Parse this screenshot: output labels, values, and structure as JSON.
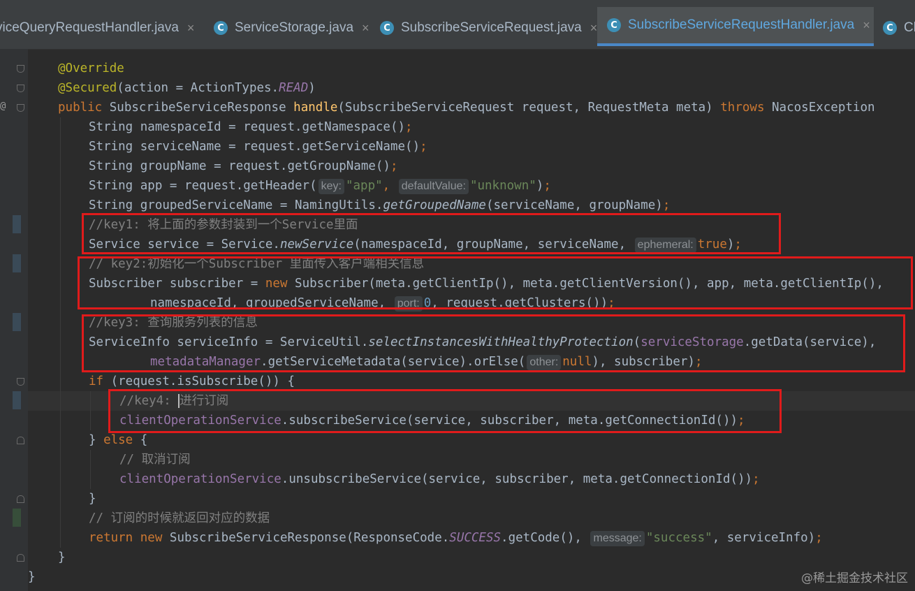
{
  "tabs": [
    {
      "name": "viceQueryRequestHandler.java",
      "icon": "java-class-icon",
      "icon_letter": "",
      "active": false
    },
    {
      "name": "ServiceStorage.java",
      "icon": "java-class-icon",
      "icon_letter": "C",
      "active": false
    },
    {
      "name": "SubscribeServiceRequest.java",
      "icon": "java-class-icon",
      "icon_letter": "C",
      "active": false
    },
    {
      "name": "SubscribeServiceRequestHandler.java",
      "icon": "java-class-icon",
      "icon_letter": "C",
      "active": true
    },
    {
      "name": "Cli",
      "icon": "java-class-icon",
      "icon_letter": "C",
      "active": false
    }
  ],
  "tab_close_glyph": "×",
  "gutter": {
    "override_marker": "@"
  },
  "code": {
    "l1": {
      "a": "@Override"
    },
    "l2": {
      "a": "@Secured",
      "b": "(action = ActionTypes.",
      "c": "READ",
      "d": ")"
    },
    "l3": {
      "a": "public ",
      "b": "SubscribeServiceResponse ",
      "c": "handle",
      "d": "(SubscribeServiceRequest request, RequestMeta meta) ",
      "e": "throws",
      "f": " NacosException"
    },
    "l4": {
      "a": "String namespaceId = request.getNamespace()",
      "b": ";"
    },
    "l5": {
      "a": "String serviceName = request.getServiceName()",
      "b": ";"
    },
    "l6": {
      "a": "String groupName = request.getGroupName()",
      "b": ";"
    },
    "l7": {
      "a": "String app = request.getHeader(",
      "hint1": "key:",
      "s1": "\"app\"",
      "c": ", ",
      "hint2": "defaultValue:",
      "s2": "\"unknown\"",
      "d": ")",
      "e": ";"
    },
    "l8": {
      "a": "String groupedServiceName = NamingUtils.",
      "b": "getGroupedName",
      "c": "(serviceName, groupName)",
      "d": ";"
    },
    "l9": {
      "a": "//key1: 将上面的参数封装到一个Service里面"
    },
    "l10": {
      "a": "Service service = Service.",
      "b": "newService",
      "c": "(namespaceId, groupName, serviceName, ",
      "hint": "ephemeral:",
      "d": "true",
      "e": ")",
      "f": ";"
    },
    "l11": {
      "a": "// key2:初始化一个Subscriber 里面传入客户端相关信息"
    },
    "l12": {
      "a": "Subscriber subscriber = ",
      "b": "new ",
      "c": "Subscriber(meta.getClientIp(), meta.getClientVersion(), app, meta.getClientIp(),"
    },
    "l13": {
      "a": "namespaceId, groupedServiceName, ",
      "hint": "port:",
      "b": "0",
      "c": ", request.getClusters())",
      "d": ";"
    },
    "l14": {
      "a": "//key3: 查询服务列表的信息"
    },
    "l15": {
      "a": "ServiceInfo serviceInfo = ServiceUtil.",
      "b": "selectInstancesWithHealthyProtection",
      "c": "(",
      "d": "serviceStorage",
      "e": ".getData(service),"
    },
    "l16": {
      "a": "metadataManager",
      "b": ".getServiceMetadata(service).orElse(",
      "hint": "other:",
      "c": "null",
      "d": "), subscriber)",
      "e": ";"
    },
    "l17": {
      "a": "if ",
      "b": "(request.isSubscribe()) {"
    },
    "l18": {
      "a": "//key4: ",
      "b": "进行订阅"
    },
    "l19": {
      "a": "clientOperationService",
      "b": ".subscribeService(service, subscriber, meta.getConnectionId())",
      "c": ";"
    },
    "l20": {
      "a": "} ",
      "b": "else ",
      "c": "{"
    },
    "l21": {
      "a": "// 取消订阅"
    },
    "l22": {
      "a": "clientOperationService",
      "b": ".unsubscribeService(service, subscriber, meta.getConnectionId())",
      "c": ";"
    },
    "l23": {
      "a": "}"
    },
    "l24": {
      "a": "// 订阅的时候就返回对应的数据"
    },
    "l25": {
      "a": "return new ",
      "b": "SubscribeServiceResponse(ResponseCode.",
      "c": "SUCCESS",
      "d": ".getCode(), ",
      "hint": "message:",
      "s": "\"success\"",
      "e": ", serviceInfo)",
      "f": ";"
    },
    "l26": {
      "a": "}"
    },
    "l27": {
      "a": "}"
    }
  },
  "watermark": "@稀土掘金技术社区",
  "colors": {
    "background": "#2b2b2b",
    "keyword": "#cc7832",
    "annotation": "#bbb529",
    "method": "#ffc66d",
    "string": "#6a8759",
    "number": "#6897bb",
    "comment": "#808080",
    "field": "#9876aa",
    "highlight_box": "#e01b1b",
    "active_tab_accent": "#4a88c7"
  }
}
